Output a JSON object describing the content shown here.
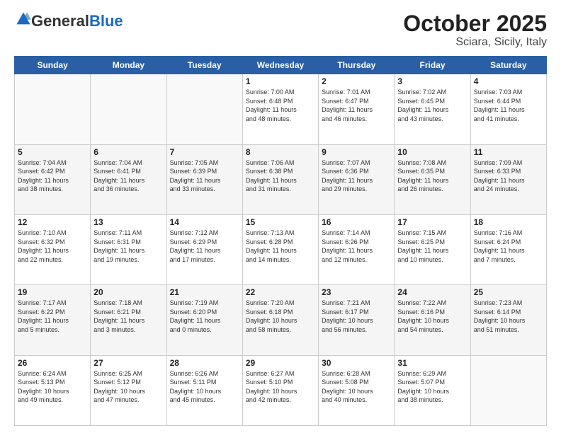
{
  "header": {
    "logo_general": "General",
    "logo_blue": "Blue",
    "month": "October 2025",
    "location": "Sciara, Sicily, Italy"
  },
  "days_of_week": [
    "Sunday",
    "Monday",
    "Tuesday",
    "Wednesday",
    "Thursday",
    "Friday",
    "Saturday"
  ],
  "weeks": [
    [
      {
        "day": "",
        "info": ""
      },
      {
        "day": "",
        "info": ""
      },
      {
        "day": "",
        "info": ""
      },
      {
        "day": "1",
        "info": "Sunrise: 7:00 AM\nSunset: 6:48 PM\nDaylight: 11 hours\nand 48 minutes."
      },
      {
        "day": "2",
        "info": "Sunrise: 7:01 AM\nSunset: 6:47 PM\nDaylight: 11 hours\nand 46 minutes."
      },
      {
        "day": "3",
        "info": "Sunrise: 7:02 AM\nSunset: 6:45 PM\nDaylight: 11 hours\nand 43 minutes."
      },
      {
        "day": "4",
        "info": "Sunrise: 7:03 AM\nSunset: 6:44 PM\nDaylight: 11 hours\nand 41 minutes."
      }
    ],
    [
      {
        "day": "5",
        "info": "Sunrise: 7:04 AM\nSunset: 6:42 PM\nDaylight: 11 hours\nand 38 minutes."
      },
      {
        "day": "6",
        "info": "Sunrise: 7:04 AM\nSunset: 6:41 PM\nDaylight: 11 hours\nand 36 minutes."
      },
      {
        "day": "7",
        "info": "Sunrise: 7:05 AM\nSunset: 6:39 PM\nDaylight: 11 hours\nand 33 minutes."
      },
      {
        "day": "8",
        "info": "Sunrise: 7:06 AM\nSunset: 6:38 PM\nDaylight: 11 hours\nand 31 minutes."
      },
      {
        "day": "9",
        "info": "Sunrise: 7:07 AM\nSunset: 6:36 PM\nDaylight: 11 hours\nand 29 minutes."
      },
      {
        "day": "10",
        "info": "Sunrise: 7:08 AM\nSunset: 6:35 PM\nDaylight: 11 hours\nand 26 minutes."
      },
      {
        "day": "11",
        "info": "Sunrise: 7:09 AM\nSunset: 6:33 PM\nDaylight: 11 hours\nand 24 minutes."
      }
    ],
    [
      {
        "day": "12",
        "info": "Sunrise: 7:10 AM\nSunset: 6:32 PM\nDaylight: 11 hours\nand 22 minutes."
      },
      {
        "day": "13",
        "info": "Sunrise: 7:11 AM\nSunset: 6:31 PM\nDaylight: 11 hours\nand 19 minutes."
      },
      {
        "day": "14",
        "info": "Sunrise: 7:12 AM\nSunset: 6:29 PM\nDaylight: 11 hours\nand 17 minutes."
      },
      {
        "day": "15",
        "info": "Sunrise: 7:13 AM\nSunset: 6:28 PM\nDaylight: 11 hours\nand 14 minutes."
      },
      {
        "day": "16",
        "info": "Sunrise: 7:14 AM\nSunset: 6:26 PM\nDaylight: 11 hours\nand 12 minutes."
      },
      {
        "day": "17",
        "info": "Sunrise: 7:15 AM\nSunset: 6:25 PM\nDaylight: 11 hours\nand 10 minutes."
      },
      {
        "day": "18",
        "info": "Sunrise: 7:16 AM\nSunset: 6:24 PM\nDaylight: 11 hours\nand 7 minutes."
      }
    ],
    [
      {
        "day": "19",
        "info": "Sunrise: 7:17 AM\nSunset: 6:22 PM\nDaylight: 11 hours\nand 5 minutes."
      },
      {
        "day": "20",
        "info": "Sunrise: 7:18 AM\nSunset: 6:21 PM\nDaylight: 11 hours\nand 3 minutes."
      },
      {
        "day": "21",
        "info": "Sunrise: 7:19 AM\nSunset: 6:20 PM\nDaylight: 11 hours\nand 0 minutes."
      },
      {
        "day": "22",
        "info": "Sunrise: 7:20 AM\nSunset: 6:18 PM\nDaylight: 10 hours\nand 58 minutes."
      },
      {
        "day": "23",
        "info": "Sunrise: 7:21 AM\nSunset: 6:17 PM\nDaylight: 10 hours\nand 56 minutes."
      },
      {
        "day": "24",
        "info": "Sunrise: 7:22 AM\nSunset: 6:16 PM\nDaylight: 10 hours\nand 54 minutes."
      },
      {
        "day": "25",
        "info": "Sunrise: 7:23 AM\nSunset: 6:14 PM\nDaylight: 10 hours\nand 51 minutes."
      }
    ],
    [
      {
        "day": "26",
        "info": "Sunrise: 6:24 AM\nSunset: 5:13 PM\nDaylight: 10 hours\nand 49 minutes."
      },
      {
        "day": "27",
        "info": "Sunrise: 6:25 AM\nSunset: 5:12 PM\nDaylight: 10 hours\nand 47 minutes."
      },
      {
        "day": "28",
        "info": "Sunrise: 6:26 AM\nSunset: 5:11 PM\nDaylight: 10 hours\nand 45 minutes."
      },
      {
        "day": "29",
        "info": "Sunrise: 6:27 AM\nSunset: 5:10 PM\nDaylight: 10 hours\nand 42 minutes."
      },
      {
        "day": "30",
        "info": "Sunrise: 6:28 AM\nSunset: 5:08 PM\nDaylight: 10 hours\nand 40 minutes."
      },
      {
        "day": "31",
        "info": "Sunrise: 6:29 AM\nSunset: 5:07 PM\nDaylight: 10 hours\nand 38 minutes."
      },
      {
        "day": "",
        "info": ""
      }
    ]
  ]
}
